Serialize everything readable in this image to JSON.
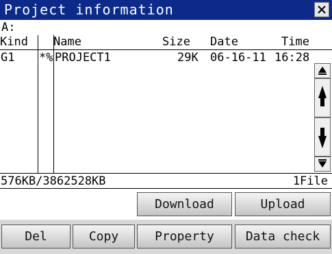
{
  "window": {
    "title": "Project information"
  },
  "drive": {
    "label": "A:"
  },
  "columns": [
    "Kind",
    "Name",
    "Size",
    "Date",
    "Time"
  ],
  "files": [
    {
      "kind": "G1",
      "flag": "*%",
      "name": "PROJECT1",
      "size": "29K",
      "date": "06-16-11",
      "time": "16:28"
    }
  ],
  "summary": {
    "usage": "576KB/3862528KB",
    "file_count": "1File"
  },
  "buttons": {
    "download": "Download",
    "upload": "Upload",
    "del": "Del",
    "copy": "Copy",
    "property": "Property",
    "data_check": "Data check"
  },
  "icons": {
    "close": "close-icon",
    "scroll_top": "scroll-top-icon",
    "page_up": "page-up-icon",
    "page_down": "page-down-icon",
    "scroll_bottom": "scroll-bottom-icon"
  },
  "colors": {
    "titlebar": "#0c2a8a"
  }
}
